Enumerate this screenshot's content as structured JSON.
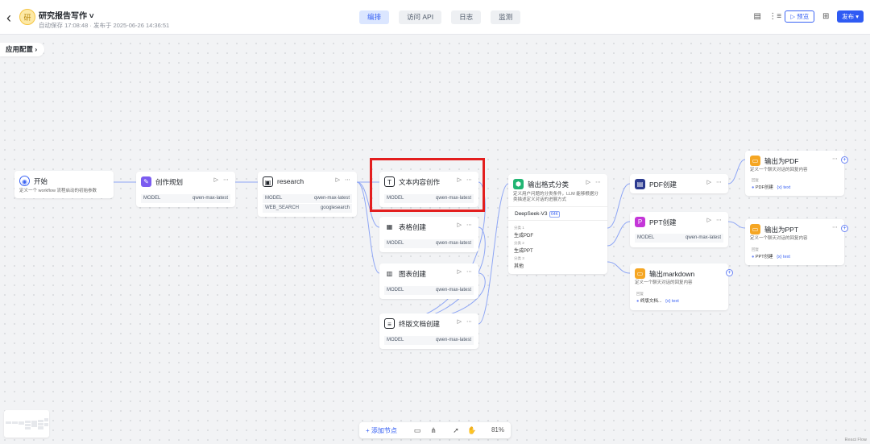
{
  "header": {
    "back": "‹",
    "app_icon": "研",
    "app_title": "研究报告写作 ˅",
    "subtitle": "自动保存 17:08:48 · 发布于 2025-06-26 14:36:51",
    "tabs": [
      {
        "label": "编排",
        "active": true
      },
      {
        "label": "访问 API",
        "active": false
      },
      {
        "label": "日志",
        "active": false
      },
      {
        "label": "监测",
        "active": false
      }
    ],
    "preview_label": "▷ 预览",
    "publish_label": "发布 ▾"
  },
  "app_config": "应用配置 ›",
  "nodes": {
    "start": {
      "title": "开始",
      "desc": "定义一个 workflow 流程启动的初始参数"
    },
    "plan": {
      "title": "创作规划",
      "model_label": "MODEL",
      "model": "qwen-max-latest"
    },
    "research": {
      "title": "research",
      "model_label": "MODEL",
      "model": "qwen-max-latest",
      "search_label": "WEB_SEARCH",
      "search": "googlesearch"
    },
    "text": {
      "title": "文本内容创作",
      "model_label": "MODEL",
      "model": "qwen-max-latest"
    },
    "table": {
      "title": "表格创建",
      "model_label": "MODEL",
      "model": "qwen-max-latest"
    },
    "chart": {
      "title": "图表创建",
      "model_label": "MODEL",
      "model": "qwen-max-latest"
    },
    "final": {
      "title": "终版文档创建",
      "model_label": "MODEL",
      "model": "qwen-max-latest"
    },
    "classify": {
      "title": "输出格式分类",
      "desc": "定义用户问题的分类条件，LLM 能够根据分类描述定义对话的进展方式",
      "model": "DeepSeek-V3",
      "badge": "64K",
      "cls1_label": "分类 1",
      "cls1": "生成PDF",
      "cls2_label": "分类 2",
      "cls2": "生成PPT",
      "cls3_label": "分类 3",
      "cls3": "其他"
    },
    "pdf": {
      "title": "PDF创建"
    },
    "ppt": {
      "title": "PPT创建",
      "model_label": "MODEL",
      "model": "qwen-max-latest"
    },
    "md": {
      "title": "输出markdown",
      "desc": "定义一个聊天对话的回复内容",
      "out_label": "回复",
      "var": "终版文档...",
      "text": "{x} text"
    },
    "out_pdf": {
      "title": "输出为PDF",
      "desc": "定义一个聊天对话的回复内容",
      "out_label": "回复",
      "var": "PDF创建",
      "text": "{x} text"
    },
    "out_ppt": {
      "title": "输出为PPT",
      "desc": "定义一个聊天对话的回复内容",
      "out_label": "回复",
      "var": "PPT创建",
      "text": "{x} text"
    }
  },
  "toolbar": {
    "add_node": "+ 添加节点",
    "zoom": "81%"
  },
  "footer": {
    "react_flow": "React Flow"
  },
  "colors": {
    "accent": "#2f5bf3",
    "highlight": "#e31e1e"
  }
}
